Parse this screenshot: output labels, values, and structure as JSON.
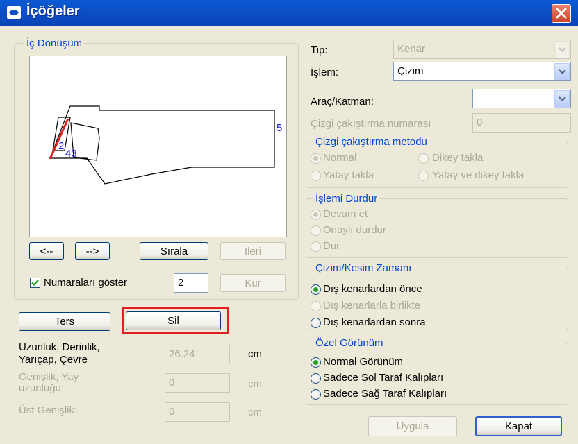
{
  "window": {
    "title": "İçöğeler",
    "close_icon": "close-icon"
  },
  "left": {
    "group_title": "İç Dönüşüm",
    "preview_numbers": [
      "2",
      "43",
      "5"
    ],
    "nav_prev": "<--",
    "nav_next": "-->",
    "sort_label": "Sırala",
    "forward_label": "İleri",
    "show_numbers_label": "Numaraları göster",
    "show_numbers_checked": true,
    "number_value": "2",
    "set_label": "Kur",
    "reverse_label": "Ters",
    "delete_label": "Sil",
    "length_label_1": "Uzunluk, Derinlik,",
    "length_label_2": "Yarıçap, Çevre",
    "length_value": "26.24",
    "length_unit": "cm",
    "width_label_1": "Genişlik, Yay",
    "width_label_2": "uzunluğu:",
    "width_value": "0",
    "width_unit": "cm",
    "top_width_label": "Üst Genişlik:",
    "top_width_value": "0",
    "top_width_unit": "cm"
  },
  "right": {
    "type_label": "Tip:",
    "type_value": "Kenar",
    "operation_label": "İşlem:",
    "operation_value": "Çizim",
    "tool_layer_label": "Araç/Katman:",
    "tool_layer_value": "",
    "line_overlap_label": "Çizgi çakıştırma numarası",
    "line_overlap_value": "0",
    "overlap_method": {
      "title": "Çizgi çakıştırma metodu",
      "options": [
        "Normal",
        "Dikey takla",
        "Yatay takla",
        "Yatay ve dikey takla"
      ],
      "selected": 0
    },
    "stop_operation": {
      "title": "İşlemi Durdur",
      "options": [
        "Devam et",
        "Onaylı durdur",
        "Dur"
      ],
      "selected": 0
    },
    "draw_cut_time": {
      "title": "Çizim/Kesim Zamanı",
      "options": [
        "Dış kenarlardan önce",
        "Dış kenarlarla birlikte",
        "Dış kenarlardan sonra"
      ],
      "selected": 0
    },
    "special_view": {
      "title": "Özel Görünüm",
      "options": [
        "Normal Görünüm",
        "Sadece Sol Taraf Kalıpları",
        "Sadece Sağ Taraf Kalıpları"
      ],
      "selected": 0
    }
  },
  "footer": {
    "apply_label": "Uygula",
    "close_label": "Kapat"
  },
  "colors": {
    "title_bar": "#0b4fc4",
    "group_title": "#0046d5",
    "highlight": "#e02020",
    "radio_selected": "#21a121",
    "preview_number": "#1e1ee0"
  }
}
